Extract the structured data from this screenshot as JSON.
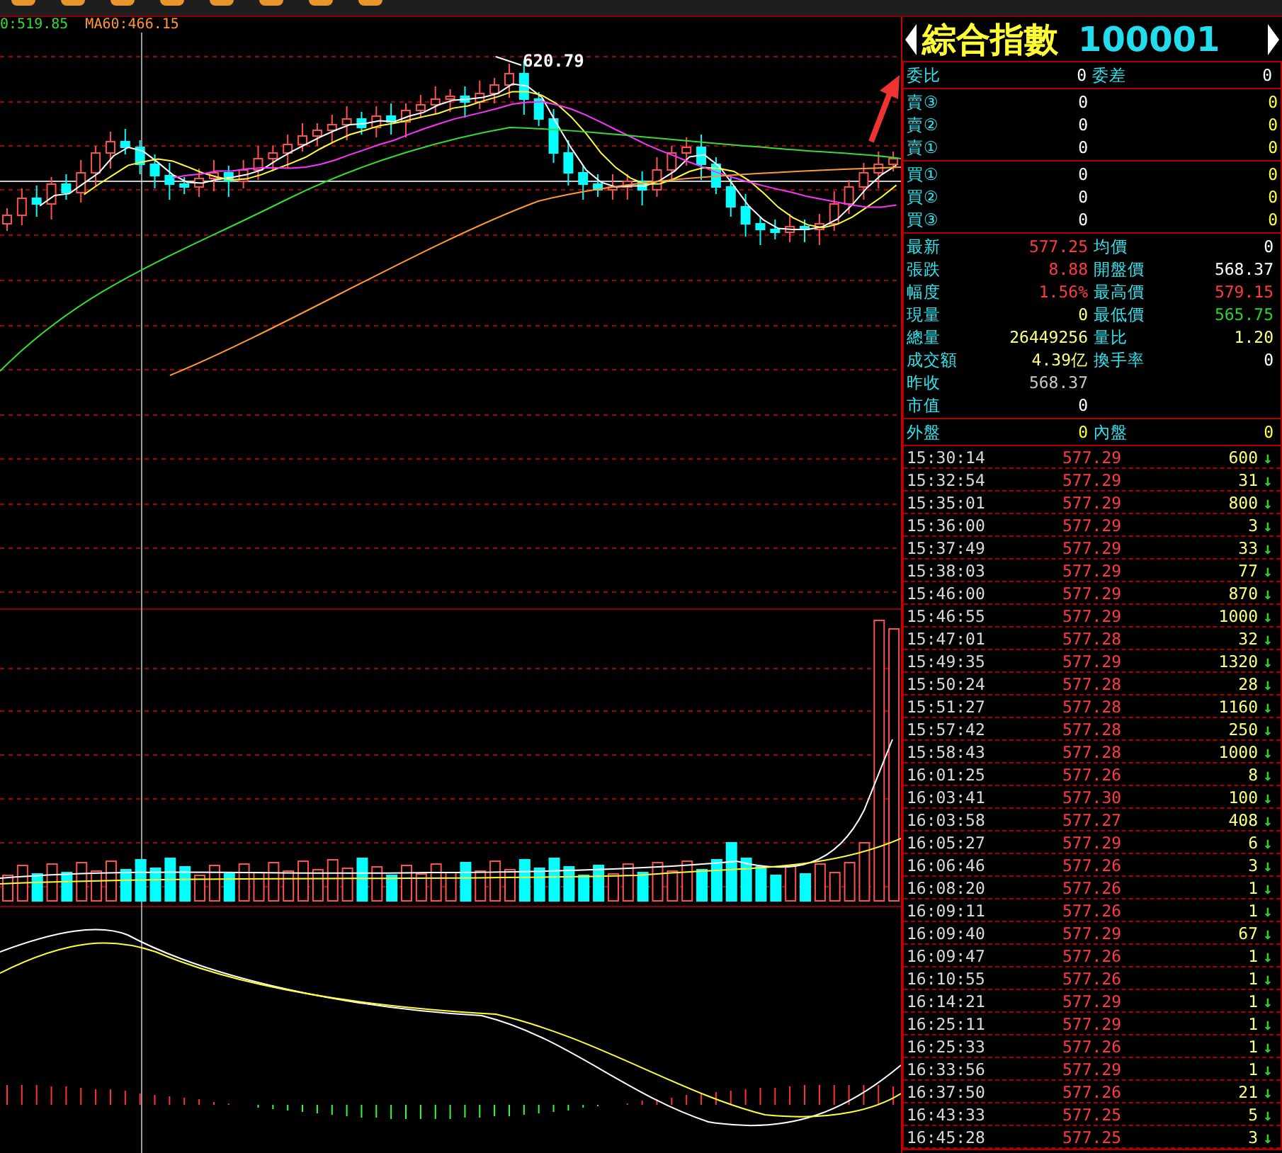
{
  "chart": {
    "ma_labels": [
      {
        "text": "0:519.85",
        "kind": "ma20"
      },
      {
        "text": "MA60:466.15",
        "kind": "ma60"
      }
    ],
    "high_label": "620.79"
  },
  "quote": {
    "name": "綜合指數",
    "code": "100001"
  },
  "order_summary": [
    {
      "label": "委比",
      "value": "0"
    },
    {
      "label": "委差",
      "value": "0"
    }
  ],
  "asks": [
    {
      "label": "賣③",
      "price": "0",
      "volume": "0"
    },
    {
      "label": "賣②",
      "price": "0",
      "volume": "0"
    },
    {
      "label": "賣①",
      "price": "0",
      "volume": "0"
    }
  ],
  "bids": [
    {
      "label": "買①",
      "price": "0",
      "volume": "0"
    },
    {
      "label": "買②",
      "price": "0",
      "volume": "0"
    },
    {
      "label": "買③",
      "price": "0",
      "volume": "0"
    }
  ],
  "stats": [
    {
      "left": {
        "label": "最新",
        "value": "577.25",
        "color": "#ff3b3b"
      },
      "right": {
        "label": "均價",
        "value": "0",
        "color": "#ffffff"
      }
    },
    {
      "left": {
        "label": "張跌",
        "value": "8.88",
        "color": "#ff3b3b"
      },
      "right": {
        "label": "開盤價",
        "value": "568.37",
        "color": "#ffffff"
      }
    },
    {
      "left": {
        "label": "幅度",
        "value": "1.56%",
        "color": "#ff3b3b"
      },
      "right": {
        "label": "最高價",
        "value": "579.15",
        "color": "#ff3b3b"
      }
    },
    {
      "left": {
        "label": "現量",
        "value": "0",
        "color": "#ffff80"
      },
      "right": {
        "label": "最低價",
        "value": "565.75",
        "color": "#2fd12f"
      }
    },
    {
      "left": {
        "label": "總量",
        "value": "26449256",
        "color": "#ffff80"
      },
      "right": {
        "label": "量比",
        "value": "1.20",
        "color": "#ffff80"
      }
    },
    {
      "left": {
        "label": "成交額",
        "value": "4.39亿",
        "color": "#ffff80"
      },
      "right": {
        "label": "換手率",
        "value": "0",
        "color": "#ffffff"
      }
    },
    {
      "left": {
        "label": "昨收",
        "value": "568.37",
        "color": "#c8c8c8"
      }
    },
    {
      "left": {
        "label": "市值",
        "value": "0",
        "color": "#ffffff"
      }
    }
  ],
  "outer_inner": [
    {
      "label": "外盤",
      "value": "0"
    },
    {
      "label": "內盤",
      "value": "0"
    }
  ],
  "trades": [
    {
      "time": "15:30:14",
      "price": "577.29",
      "volume": "600",
      "arrow": "↓"
    },
    {
      "time": "15:32:54",
      "price": "577.29",
      "volume": "31",
      "arrow": "↓"
    },
    {
      "time": "15:35:01",
      "price": "577.29",
      "volume": "800",
      "arrow": "↓"
    },
    {
      "time": "15:36:00",
      "price": "577.29",
      "volume": "3",
      "arrow": "↓"
    },
    {
      "time": "15:37:49",
      "price": "577.29",
      "volume": "33",
      "arrow": "↓"
    },
    {
      "time": "15:38:03",
      "price": "577.29",
      "volume": "77",
      "arrow": "↓"
    },
    {
      "time": "15:46:00",
      "price": "577.29",
      "volume": "870",
      "arrow": "↓"
    },
    {
      "time": "15:46:55",
      "price": "577.29",
      "volume": "1000",
      "arrow": "↓"
    },
    {
      "time": "15:47:01",
      "price": "577.28",
      "volume": "32",
      "arrow": "↓"
    },
    {
      "time": "15:49:35",
      "price": "577.29",
      "volume": "1320",
      "arrow": "↓"
    },
    {
      "time": "15:50:24",
      "price": "577.28",
      "volume": "28",
      "arrow": "↓"
    },
    {
      "time": "15:51:27",
      "price": "577.28",
      "volume": "1160",
      "arrow": "↓"
    },
    {
      "time": "15:57:42",
      "price": "577.28",
      "volume": "250",
      "arrow": "↓"
    },
    {
      "time": "15:58:43",
      "price": "577.28",
      "volume": "1000",
      "arrow": "↓"
    },
    {
      "time": "16:01:25",
      "price": "577.26",
      "volume": "8",
      "arrow": "↓"
    },
    {
      "time": "16:03:41",
      "price": "577.30",
      "volume": "100",
      "arrow": "↓"
    },
    {
      "time": "16:03:58",
      "price": "577.27",
      "volume": "408",
      "arrow": "↓"
    },
    {
      "time": "16:05:27",
      "price": "577.29",
      "volume": "6",
      "arrow": "↓"
    },
    {
      "time": "16:06:46",
      "price": "577.26",
      "volume": "3",
      "arrow": "↓"
    },
    {
      "time": "16:08:20",
      "price": "577.26",
      "volume": "1",
      "arrow": "↓"
    },
    {
      "time": "16:09:11",
      "price": "577.26",
      "volume": "1",
      "arrow": "↓"
    },
    {
      "time": "16:09:40",
      "price": "577.29",
      "volume": "67",
      "arrow": "↓"
    },
    {
      "time": "16:09:47",
      "price": "577.26",
      "volume": "1",
      "arrow": "↓"
    },
    {
      "time": "16:10:55",
      "price": "577.26",
      "volume": "1",
      "arrow": "↓"
    },
    {
      "time": "16:14:21",
      "price": "577.29",
      "volume": "1",
      "arrow": "↓"
    },
    {
      "time": "16:25:11",
      "price": "577.29",
      "volume": "1",
      "arrow": "↓"
    },
    {
      "time": "16:25:33",
      "price": "577.26",
      "volume": "1",
      "arrow": "↓"
    },
    {
      "time": "16:33:56",
      "price": "577.29",
      "volume": "1",
      "arrow": "↓"
    },
    {
      "time": "16:37:50",
      "price": "577.26",
      "volume": "21",
      "arrow": "↓"
    },
    {
      "time": "16:43:33",
      "price": "577.25",
      "volume": "5",
      "arrow": "↓"
    },
    {
      "time": "16:45:28",
      "price": "577.25",
      "volume": "3",
      "arrow": "↓"
    }
  ]
}
